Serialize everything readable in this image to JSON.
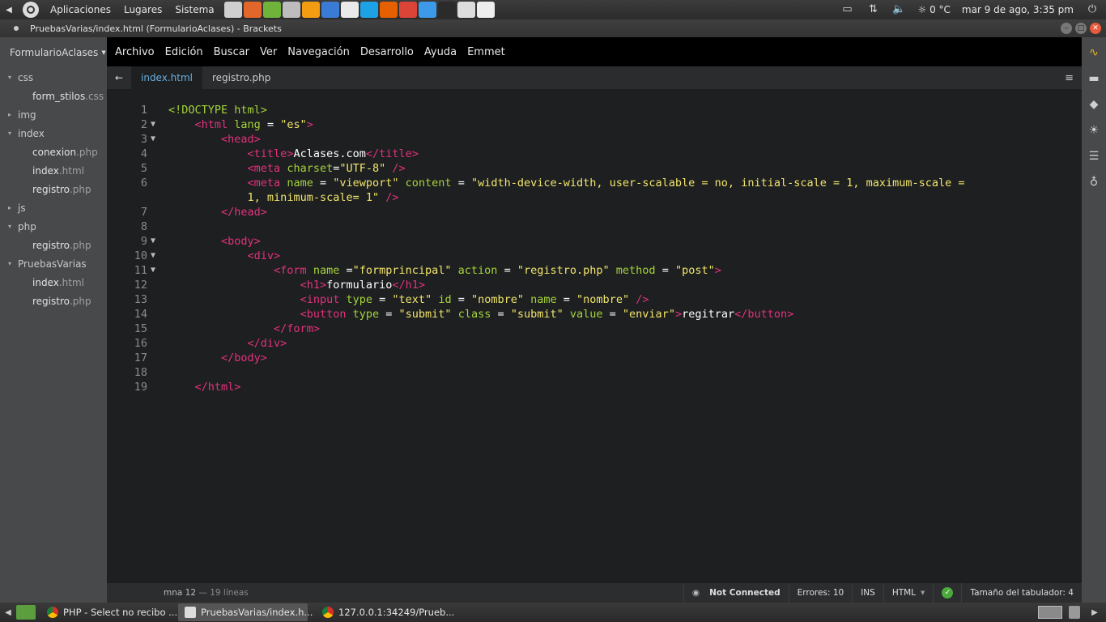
{
  "top_panel": {
    "menus": [
      "Aplicaciones",
      "Lugares",
      "Sistema"
    ],
    "launchers": [
      {
        "icon": "printer-icon",
        "color": "#cfcfcf"
      },
      {
        "icon": "software-center-icon",
        "color": "#e3662a"
      },
      {
        "icon": "update-manager-icon",
        "color": "#6fb33a"
      },
      {
        "icon": "system-icon",
        "color": "#bdbdbd"
      },
      {
        "icon": "vlc-icon",
        "color": "#f39c12"
      },
      {
        "icon": "screenshot-icon",
        "color": "#3a7bd5"
      },
      {
        "icon": "document-icon",
        "color": "#eaeaea"
      },
      {
        "icon": "skype-icon",
        "color": "#1ea2e6"
      },
      {
        "icon": "firefox-icon",
        "color": "#e66000"
      },
      {
        "icon": "chrome-icon",
        "color": "#db4437"
      },
      {
        "icon": "dropbox-icon",
        "color": "#3d9ae8"
      },
      {
        "icon": "terminal-icon",
        "color": "#2b2b2b"
      },
      {
        "icon": "scanner-icon",
        "color": "#dddddd"
      },
      {
        "icon": "text-editor-icon",
        "color": "#eeeeee"
      }
    ],
    "temperature": "0 °C",
    "datetime": "mar 9 de ago, 3:35 pm"
  },
  "window": {
    "title": "PruebasVarias/index.html (FormularioAclases) - Brackets"
  },
  "sidebar": {
    "project": "FormularioAclases",
    "tree": [
      {
        "type": "folder",
        "name": "css"
      },
      {
        "type": "file",
        "name": "form_stilos",
        "ext": ".css"
      },
      {
        "type": "folder",
        "name": "img",
        "collapsed": true
      },
      {
        "type": "folder",
        "name": "index"
      },
      {
        "type": "file",
        "name": "conexion",
        "ext": ".php"
      },
      {
        "type": "file",
        "name": "index",
        "ext": ".html"
      },
      {
        "type": "file",
        "name": "registro",
        "ext": ".php"
      },
      {
        "type": "folder",
        "name": "js",
        "collapsed": true
      },
      {
        "type": "folder",
        "name": "php"
      },
      {
        "type": "file",
        "name": "registro",
        "ext": ".php"
      },
      {
        "type": "folder",
        "name": "PruebasVarias"
      },
      {
        "type": "file",
        "name": "index",
        "ext": ".html"
      },
      {
        "type": "file",
        "name": "registro",
        "ext": ".php"
      }
    ]
  },
  "menubar": [
    "Archivo",
    "Edición",
    "Buscar",
    "Ver",
    "Navegación",
    "Desarrollo",
    "Ayuda",
    "Emmet"
  ],
  "tabs": {
    "back": "←",
    "items": [
      {
        "label": "index.html",
        "active": true
      },
      {
        "label": "registro.php",
        "active": false
      }
    ]
  },
  "editor": {
    "lines": [
      {
        "n": "1",
        "fold": false,
        "segs": [
          [
            "doc",
            "<!DOCTYPE html>"
          ]
        ]
      },
      {
        "n": "2",
        "fold": true,
        "segs": [
          [
            "txt",
            "    "
          ],
          [
            "tag",
            "<html"
          ],
          [
            "txt",
            " "
          ],
          [
            "attr",
            "lang"
          ],
          [
            "txt",
            " = "
          ],
          [
            "str",
            "\"es\""
          ],
          [
            "tag",
            ">"
          ]
        ]
      },
      {
        "n": "3",
        "fold": true,
        "segs": [
          [
            "txt",
            "        "
          ],
          [
            "tag",
            "<head>"
          ]
        ]
      },
      {
        "n": "4",
        "fold": false,
        "segs": [
          [
            "txt",
            "            "
          ],
          [
            "tag",
            "<title>"
          ],
          [
            "txt",
            "Aclases.com"
          ],
          [
            "tag",
            "</title>"
          ]
        ]
      },
      {
        "n": "5",
        "fold": false,
        "segs": [
          [
            "txt",
            "            "
          ],
          [
            "tag",
            "<meta"
          ],
          [
            "txt",
            " "
          ],
          [
            "attr",
            "charset"
          ],
          [
            "txt",
            "="
          ],
          [
            "str",
            "\"UTF-8\""
          ],
          [
            "txt",
            " "
          ],
          [
            "tag",
            "/>"
          ]
        ]
      },
      {
        "n": "6",
        "fold": false,
        "segs": [
          [
            "txt",
            "            "
          ],
          [
            "tag",
            "<meta"
          ],
          [
            "txt",
            " "
          ],
          [
            "attr",
            "name"
          ],
          [
            "txt",
            " = "
          ],
          [
            "str",
            "\"viewport\""
          ],
          [
            "txt",
            " "
          ],
          [
            "attr",
            "content"
          ],
          [
            "txt",
            " = "
          ],
          [
            "str",
            "\"width-device-width, user-scalable = no, initial-scale = 1, maximum-scale ="
          ]
        ]
      },
      {
        "n": "",
        "fold": false,
        "segs": [
          [
            "txt",
            "            "
          ],
          [
            "str",
            "1, minimum-scale= 1\""
          ],
          [
            "txt",
            " "
          ],
          [
            "tag",
            "/>"
          ]
        ]
      },
      {
        "n": "7",
        "fold": false,
        "segs": [
          [
            "txt",
            "        "
          ],
          [
            "tag",
            "</head>"
          ]
        ]
      },
      {
        "n": "8",
        "fold": false,
        "segs": [
          [
            "txt",
            ""
          ]
        ]
      },
      {
        "n": "9",
        "fold": true,
        "segs": [
          [
            "txt",
            "        "
          ],
          [
            "tag",
            "<body>"
          ]
        ]
      },
      {
        "n": "10",
        "fold": true,
        "segs": [
          [
            "txt",
            "            "
          ],
          [
            "tag",
            "<div>"
          ]
        ]
      },
      {
        "n": "11",
        "fold": true,
        "segs": [
          [
            "txt",
            "                "
          ],
          [
            "tag",
            "<form"
          ],
          [
            "txt",
            " "
          ],
          [
            "attr",
            "name"
          ],
          [
            "txt",
            " ="
          ],
          [
            "str",
            "\"formprincipal\""
          ],
          [
            "txt",
            " "
          ],
          [
            "attr",
            "action"
          ],
          [
            "txt",
            " = "
          ],
          [
            "str",
            "\"registro.php\""
          ],
          [
            "txt",
            " "
          ],
          [
            "attr",
            "method"
          ],
          [
            "txt",
            " = "
          ],
          [
            "str",
            "\"post\""
          ],
          [
            "tag",
            ">"
          ]
        ]
      },
      {
        "n": "12",
        "fold": false,
        "segs": [
          [
            "txt",
            "                    "
          ],
          [
            "tag",
            "<h1>"
          ],
          [
            "txt",
            "formulario"
          ],
          [
            "tag",
            "</h1>"
          ]
        ]
      },
      {
        "n": "13",
        "fold": false,
        "segs": [
          [
            "txt",
            "                    "
          ],
          [
            "tag",
            "<input"
          ],
          [
            "txt",
            " "
          ],
          [
            "attr",
            "type"
          ],
          [
            "txt",
            " = "
          ],
          [
            "str",
            "\"text\""
          ],
          [
            "txt",
            " "
          ],
          [
            "attr",
            "id"
          ],
          [
            "txt",
            " = "
          ],
          [
            "str",
            "\"nombre\""
          ],
          [
            "txt",
            " "
          ],
          [
            "attr",
            "name"
          ],
          [
            "txt",
            " = "
          ],
          [
            "str",
            "\"nombre\""
          ],
          [
            "txt",
            " "
          ],
          [
            "tag",
            "/>"
          ]
        ]
      },
      {
        "n": "14",
        "fold": false,
        "segs": [
          [
            "txt",
            "                    "
          ],
          [
            "tag",
            "<button"
          ],
          [
            "txt",
            " "
          ],
          [
            "attr",
            "type"
          ],
          [
            "txt",
            " = "
          ],
          [
            "str",
            "\"submit\""
          ],
          [
            "txt",
            " "
          ],
          [
            "attr",
            "class"
          ],
          [
            "txt",
            " = "
          ],
          [
            "str",
            "\"submit\""
          ],
          [
            "txt",
            " "
          ],
          [
            "attr",
            "value"
          ],
          [
            "txt",
            " = "
          ],
          [
            "str",
            "\"enviar\""
          ],
          [
            "tag",
            ">"
          ],
          [
            "txt",
            "regitrar"
          ],
          [
            "tag",
            "</button>"
          ]
        ]
      },
      {
        "n": "15",
        "fold": false,
        "segs": [
          [
            "txt",
            "                "
          ],
          [
            "tag",
            "</form>"
          ]
        ]
      },
      {
        "n": "16",
        "fold": false,
        "segs": [
          [
            "txt",
            "            "
          ],
          [
            "tag",
            "</div>"
          ]
        ]
      },
      {
        "n": "17",
        "fold": false,
        "segs": [
          [
            "txt",
            "        "
          ],
          [
            "tag",
            "</body>"
          ]
        ]
      },
      {
        "n": "18",
        "fold": false,
        "segs": [
          [
            "txt",
            ""
          ]
        ]
      },
      {
        "n": "19",
        "fold": false,
        "segs": [
          [
            "txt",
            "    "
          ],
          [
            "tag",
            "</html>"
          ]
        ]
      }
    ]
  },
  "statusbar": {
    "cursor": "mna 12",
    "lines_info": "— 19 líneas",
    "connection": "Not Connected",
    "errors": "Errores: 10",
    "mode": "INS",
    "language": "HTML",
    "tab_size": "Tamaño del tabulador: 4"
  },
  "taskbar": {
    "tasks": [
      {
        "label": "PHP - Select no recibo ...",
        "icon": "chrome",
        "active": false
      },
      {
        "label": "PruebasVarias/index.h...",
        "icon": "brackets",
        "active": true
      },
      {
        "label": "127.0.0.1:34249/Prueb...",
        "icon": "chrome",
        "active": false
      }
    ]
  },
  "colors": {
    "tag": "#e3327d",
    "attr": "#a6d33a",
    "string": "#f2e56b",
    "active_tab": "#6ab0de"
  }
}
